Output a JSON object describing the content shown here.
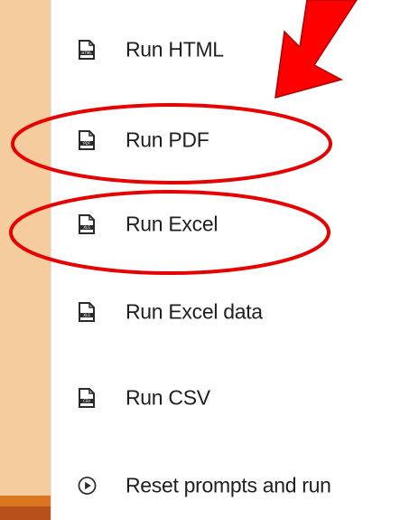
{
  "menu": {
    "items": [
      {
        "label": "Run HTML",
        "icon": "html-file-icon",
        "format": "HTML"
      },
      {
        "label": "Run PDF",
        "icon": "pdf-file-icon",
        "format": "PDF"
      },
      {
        "label": "Run Excel",
        "icon": "xls-file-icon",
        "format": "XLS"
      },
      {
        "label": "Run Excel data",
        "icon": "xls-file-icon",
        "format": "XLS"
      },
      {
        "label": "Run CSV",
        "icon": "csv-file-icon",
        "format": "CSV"
      },
      {
        "label": "Reset prompts and run",
        "icon": "play-circle-icon"
      }
    ]
  },
  "colors": {
    "background": "#f5cc9e",
    "annotation": "#ff0000",
    "text": "#1f1f1f"
  }
}
